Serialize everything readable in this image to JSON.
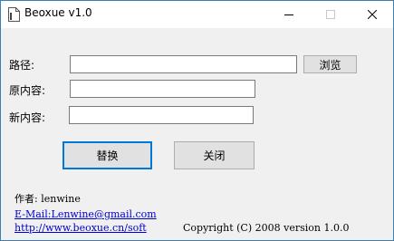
{
  "window": {
    "title": "Beoxue v1.0",
    "icon": "document-icon"
  },
  "form": {
    "path_label": "路径:",
    "path_value": "",
    "browse_label": "浏览",
    "original_label": "原内容:",
    "original_value": "",
    "new_label": "新内容:",
    "new_value": ""
  },
  "actions": {
    "replace_label": "替换",
    "close_label": "关闭"
  },
  "footer": {
    "author": "作者: lenwine",
    "email": "E-Mail:Lenwine@gmail.com",
    "website": "http://www.beoxue.cn/soft",
    "copyright": "Copyright (C) 2008 version 1.0.0"
  },
  "colors": {
    "focus_border": "#0078d7",
    "link": "#0000cc"
  }
}
